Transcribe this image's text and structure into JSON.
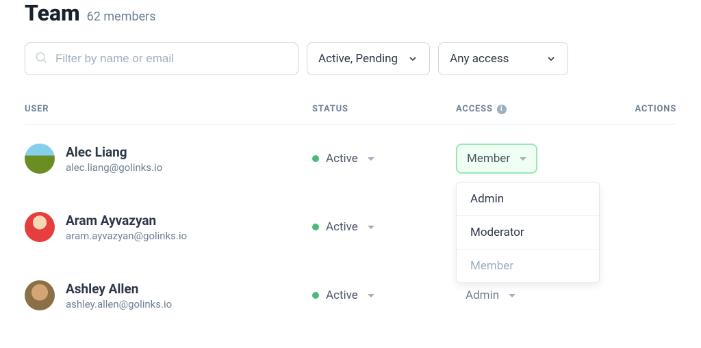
{
  "header": {
    "title": "Team",
    "subtitle": "62 members"
  },
  "filters": {
    "search_placeholder": "Filter by name or email",
    "status_label": "Active, Pending",
    "access_label": "Any access"
  },
  "columns": {
    "user": "USER",
    "status": "STATUS",
    "access": "ACCESS",
    "actions": "ACTIONS"
  },
  "users": [
    {
      "name": "Alec Liang",
      "email": "alec.liang@golinks.io",
      "status": "Active",
      "access": "Member"
    },
    {
      "name": "Aram Ayvazyan",
      "email": "aram.ayvazyan@golinks.io",
      "status": "Active",
      "access": ""
    },
    {
      "name": "Ashley Allen",
      "email": "ashley.allen@golinks.io",
      "status": "Active",
      "access": "Admin"
    }
  ],
  "access_options": {
    "admin": "Admin",
    "moderator": "Moderator",
    "member": "Member"
  },
  "colors": {
    "active_dot": "#48bb78",
    "dropdown_border": "#9ae6b4"
  }
}
